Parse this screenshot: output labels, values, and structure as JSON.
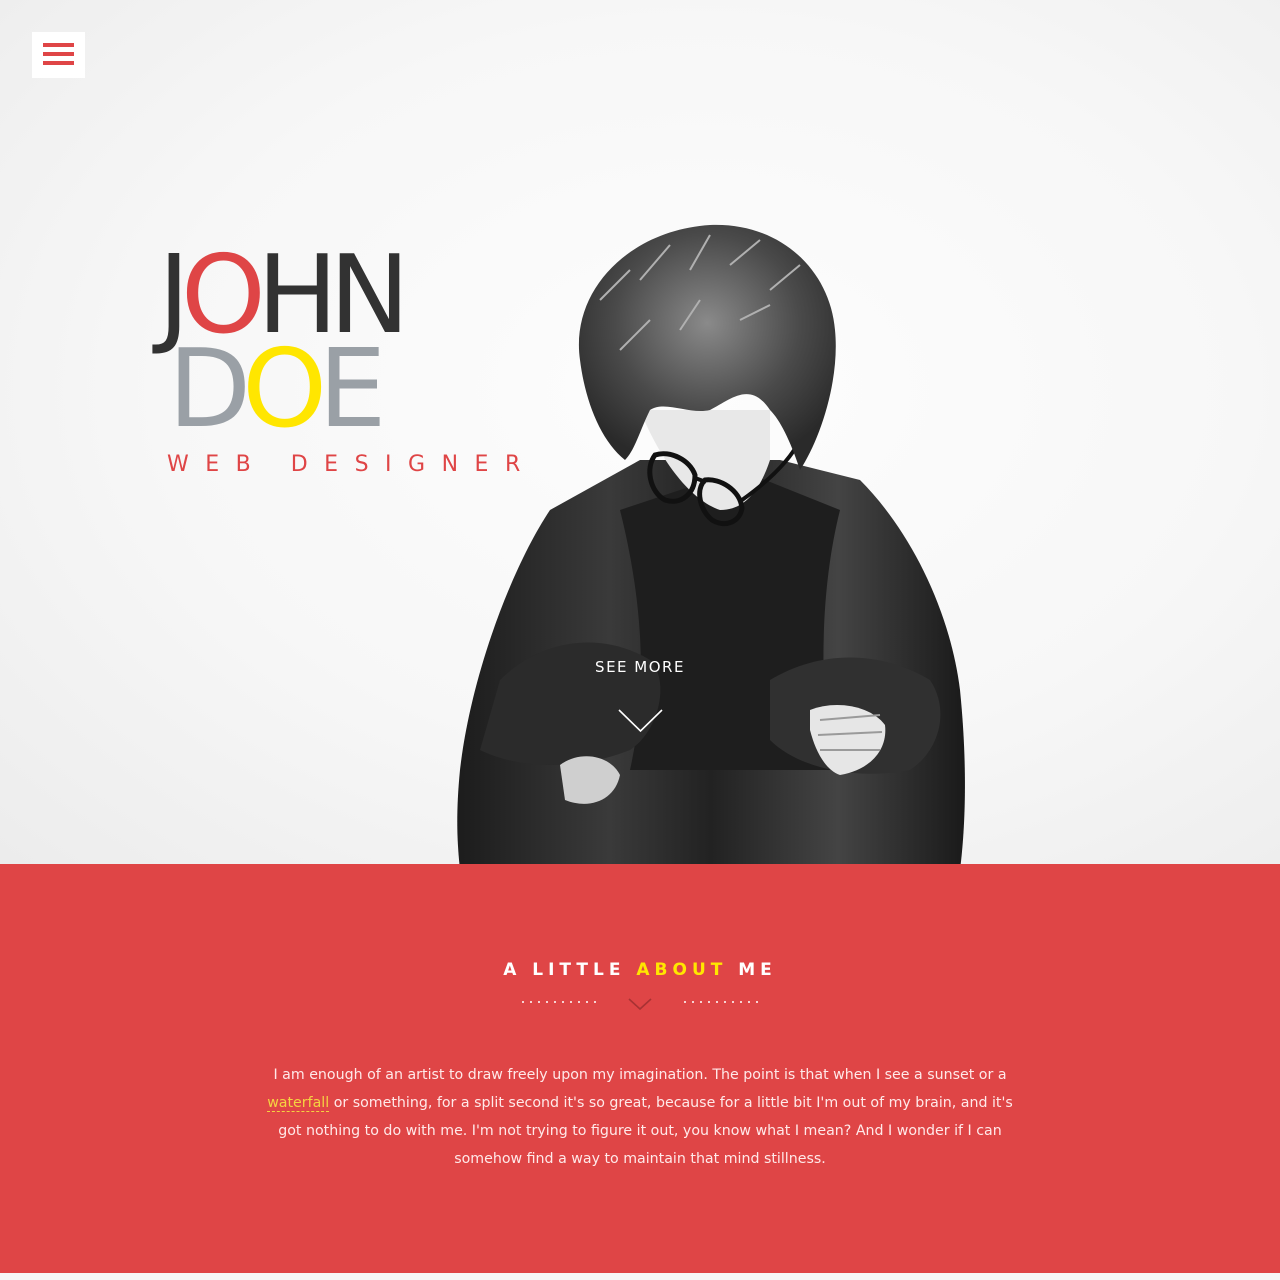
{
  "colors": {
    "accent_red": "#df4546",
    "accent_yellow": "#ffe600",
    "dark_text": "#323232",
    "grey_text": "#9aa0a6",
    "white": "#ffffff"
  },
  "menu": {
    "icon": "hamburger-menu-icon"
  },
  "hero": {
    "name_line1": [
      {
        "text": "J",
        "color": "#323232"
      },
      {
        "text": "O",
        "color": "#df4546"
      },
      {
        "text": "HN",
        "color": "#323232"
      }
    ],
    "name_line2": [
      {
        "text": "D",
        "color": "#9aa0a6"
      },
      {
        "text": "O",
        "color": "#ffe600"
      },
      {
        "text": "E",
        "color": "#9aa0a6"
      }
    ],
    "role": "WEB DESIGNER",
    "see_more_label": "SEE MORE",
    "see_more_icon": "chevron-down-icon"
  },
  "about": {
    "title_parts": [
      {
        "text": "A LITTLE ",
        "color": "#ffffff"
      },
      {
        "text": "ABOUT",
        "color": "#ffe600"
      },
      {
        "text": " ME",
        "color": "#ffffff"
      }
    ],
    "divider_icon": "chevron-down-icon",
    "body_before_link": "I am enough of an artist to draw freely upon my imagination. The point is that when I see a sunset or a ",
    "link_text": "waterfall",
    "body_after_link": " or something, for a split second it's so great, because for a little bit I'm out of my brain, and it's got nothing to do with me. I'm not trying to figure it out, you know what I mean? And I wonder if I can somehow find a way to maintain that mind stillness."
  }
}
